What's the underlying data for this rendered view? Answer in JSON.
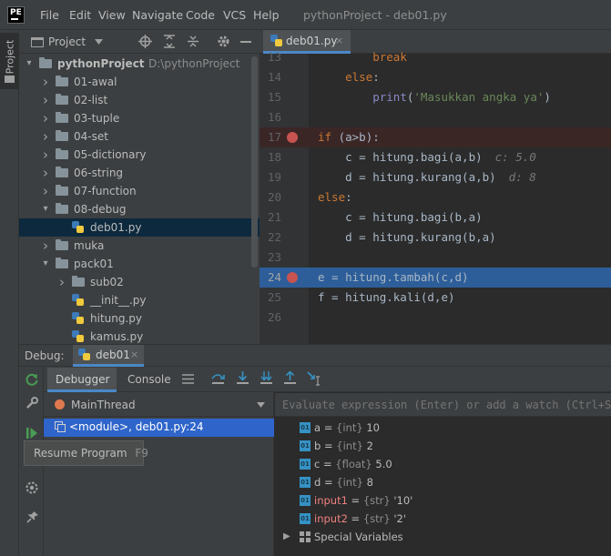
{
  "app": {
    "logo_text": "PE",
    "menu": [
      "File",
      "Edit",
      "View",
      "Navigate",
      "Code",
      "VCS",
      "Help"
    ],
    "window_title": "pythonProject - deb01.py"
  },
  "left_stripe": {
    "project_label": "Project"
  },
  "project_panel": {
    "title": "Project",
    "tree": [
      {
        "label": "pythonProject",
        "hint": "D:\\pythonProject",
        "kind": "folder",
        "expanded": true,
        "level": 0
      },
      {
        "label": "01-awal",
        "kind": "folder",
        "expanded": false,
        "level": 1
      },
      {
        "label": "02-list",
        "kind": "folder",
        "expanded": false,
        "level": 1
      },
      {
        "label": "03-tuple",
        "kind": "folder",
        "expanded": false,
        "level": 1
      },
      {
        "label": "04-set",
        "kind": "folder",
        "expanded": false,
        "level": 1
      },
      {
        "label": "05-dictionary",
        "kind": "folder",
        "expanded": false,
        "level": 1
      },
      {
        "label": "06-string",
        "kind": "folder",
        "expanded": false,
        "level": 1
      },
      {
        "label": "07-function",
        "kind": "folder",
        "expanded": false,
        "level": 1
      },
      {
        "label": "08-debug",
        "kind": "folder",
        "expanded": true,
        "level": 1
      },
      {
        "label": "deb01.py",
        "kind": "python-file",
        "level": 2,
        "selected": true
      },
      {
        "label": "muka",
        "kind": "folder",
        "expanded": false,
        "level": 1
      },
      {
        "label": "pack01",
        "kind": "folder",
        "expanded": true,
        "level": 1
      },
      {
        "label": "sub02",
        "kind": "folder",
        "expanded": false,
        "level": 2
      },
      {
        "label": "__init__.py",
        "kind": "python-file",
        "level": 2
      },
      {
        "label": "hitung.py",
        "kind": "python-file",
        "level": 2
      },
      {
        "label": "kamus.py",
        "kind": "python-file",
        "level": 2
      }
    ]
  },
  "editor": {
    "tab_label": "deb01.py",
    "lines": [
      {
        "n": "13",
        "text": "        break"
      },
      {
        "n": "14",
        "text": "    else:"
      },
      {
        "n": "15",
        "text": "        print('Masukkan angka ya')"
      },
      {
        "n": "16",
        "text": ""
      },
      {
        "n": "17",
        "text": "if (a>b):",
        "breakpoint": true
      },
      {
        "n": "18",
        "text": "    c = hitung.bagi(a,b)",
        "hint": "c: 5.0"
      },
      {
        "n": "19",
        "text": "    d = hitung.kurang(a,b)",
        "hint": "d: 8"
      },
      {
        "n": "20",
        "text": "else:"
      },
      {
        "n": "21",
        "text": "    c = hitung.bagi(b,a)"
      },
      {
        "n": "22",
        "text": "    d = hitung.kurang(b,a)"
      },
      {
        "n": "23",
        "text": ""
      },
      {
        "n": "24",
        "text": "e = hitung.tambah(c,d)",
        "breakpoint": true,
        "current": true
      },
      {
        "n": "25",
        "text": "f = hitung.kali(d,e)"
      },
      {
        "n": "26",
        "text": ""
      }
    ]
  },
  "debug": {
    "label": "Debug:",
    "session_tab": "deb01",
    "tabs": {
      "debugger": "Debugger",
      "console": "Console"
    },
    "thread": "MainThread",
    "frame": "<module>, deb01.py:24",
    "eval_placeholder": "Evaluate expression (Enter) or add a watch (Ctrl+Shift+Enter)",
    "variables": [
      {
        "name": "a",
        "type": "{int}",
        "value": "10"
      },
      {
        "name": "b",
        "type": "{int}",
        "value": "2"
      },
      {
        "name": "c",
        "type": "{float}",
        "value": "5.0"
      },
      {
        "name": "d",
        "type": "{int}",
        "value": "8"
      },
      {
        "name": "input1",
        "type": "{str}",
        "value": "'10'",
        "changed": true
      },
      {
        "name": "input2",
        "type": "{str}",
        "value": "'2'",
        "changed": true
      }
    ],
    "special_variables": "Special Variables",
    "var_badge": "01",
    "tooltip": {
      "text": "Resume Program",
      "shortcut": "F9"
    }
  },
  "colors": {
    "accent": "#4a88c7",
    "breakpoint": "#c75450",
    "exec_line": "#2d5e99",
    "selected_frame": "#2f65ca"
  }
}
